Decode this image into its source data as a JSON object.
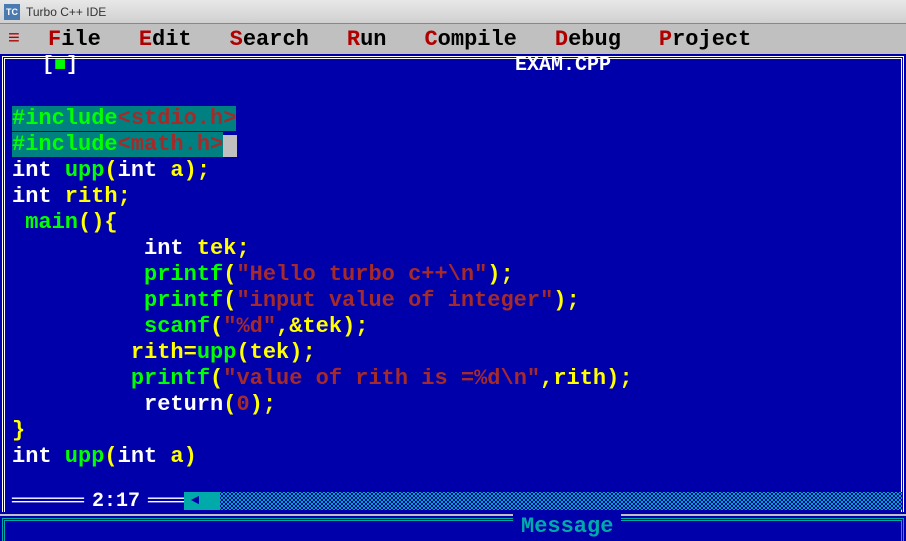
{
  "titlebar": {
    "title": "Turbo C++ IDE"
  },
  "menubar": {
    "items": [
      {
        "hotkey": "F",
        "rest": "ile"
      },
      {
        "hotkey": "E",
        "rest": "dit"
      },
      {
        "hotkey": "S",
        "rest": "earch"
      },
      {
        "hotkey": "R",
        "rest": "un"
      },
      {
        "hotkey": "C",
        "rest": "ompile"
      },
      {
        "hotkey": "D",
        "rest": "ebug"
      },
      {
        "hotkey": "P",
        "rest": "roject"
      }
    ]
  },
  "editor": {
    "filename": " EXAM.CPP ",
    "cursor_position": "2:17",
    "code": {
      "line1_preproc": "#include",
      "line1_inc": "<stdio.h>",
      "line2_preproc": "#include",
      "line2_inc": "<math.h>",
      "line3_int": "int",
      "line3_fn": "upp",
      "line3_lp": "(",
      "line3_param_t": "int",
      "line3_param_n": " a",
      "line3_rp": ");",
      "line4_int": "int",
      "line4_var": " rith",
      "line4_semi": ";",
      "line5_main": " main",
      "line5_paren": "(){",
      "line6_int": "          int",
      "line6_var": " tek",
      "line6_semi": ";",
      "line7_fn": "          printf",
      "line7_lp": "(",
      "line7_str": "\"Hello turbo c++\\n\"",
      "line7_rp": ");",
      "line8_fn": "          printf",
      "line8_lp": "(",
      "line8_str": "\"input value of integer\"",
      "line8_rp": ");",
      "line9_fn": "          scanf",
      "line9_lp": "(",
      "line9_str": "\"%d\"",
      "line9_comma": ",&",
      "line9_var": "tek",
      "line9_rp": ");",
      "line10_lhs": "         rith",
      "line10_eq": "=",
      "line10_fn": "upp",
      "line10_lp": "(",
      "line10_arg": "tek",
      "line10_rp": ");",
      "line11_fn": "         printf",
      "line11_lp": "(",
      "line11_str": "\"value of rith is =%d\\n\"",
      "line11_comma": ",",
      "line11_var": "rith",
      "line11_rp": ");",
      "line12_ret": "          return",
      "line12_lp": "(",
      "line12_num": "0",
      "line12_rp": ");",
      "line13_brace": "}",
      "line14_int": "int",
      "line14_fn": " upp",
      "line14_lp": "(",
      "line14_param_t": "int",
      "line14_param_n": " a",
      "line14_rp": ")"
    }
  },
  "message_panel": {
    "title": " Message "
  }
}
